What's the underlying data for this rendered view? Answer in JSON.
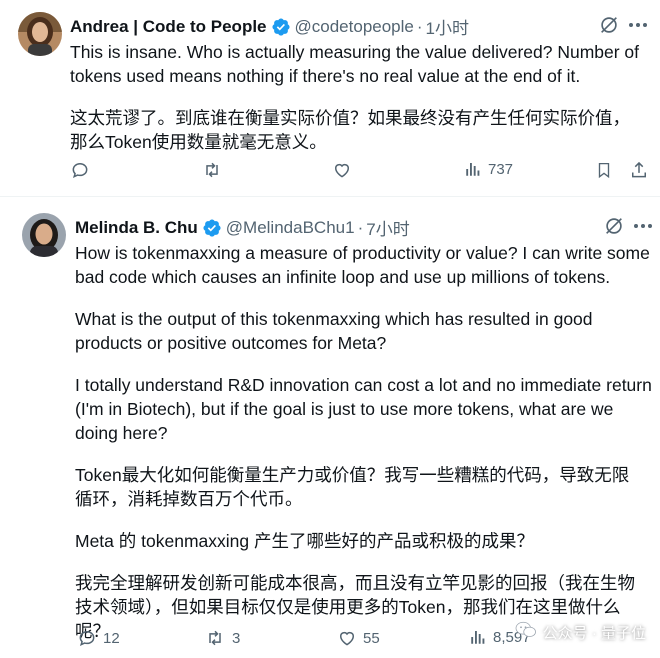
{
  "tweets": [
    {
      "author_name": "Andrea | Code to People",
      "handle": "@codetopeople",
      "separator": "·",
      "time": "1小时",
      "text_en": "This is insane. Who is actually measuring the value delivered? Number of tokens used means nothing if there's no real value at the end of it.",
      "text_zh": "这太荒谬了。到底谁在衡量实际价值？如果最终没有产生任何实际价值，那么Token使用数量就毫无意义。",
      "views": "737",
      "replies": "",
      "retweets": "",
      "likes": ""
    },
    {
      "author_name": "Melinda B. Chu",
      "handle": "@MelindaBChu1",
      "separator": "·",
      "time": "7小时",
      "paragraphs": [
        "How is tokenmaxxing a measure of productivity or value?  I can write some bad code which causes an infinite loop and use up millions of tokens.",
        "What is the output of this tokenmaxxing which has resulted in good products or positive outcomes for Meta?",
        "I totally understand R&D innovation can cost a lot and no immediate return (I'm in Biotech), but if the goal is just to use more tokens, what are we doing here?",
        "Token最大化如何能衡量生产力或价值？我写一些糟糕的代码，导致无限循环，消耗掉数百万个代币。",
        "Meta 的 tokenmaxxing 产生了哪些好的产品或积极的成果？",
        "我完全理解研发创新可能成本很高，而且没有立竿见影的回报（我在生物技术领域），但如果目标仅仅是使用更多的Token，那我们在这里做什么呢？"
      ],
      "replies": "12",
      "retweets": "3",
      "likes": "55",
      "views": "8,597"
    }
  ],
  "watermark": "公众号 · 量子位",
  "colors": {
    "text": "#0f1419",
    "muted": "#536471",
    "verified": "#1d9bf0",
    "divider": "#eff3f4"
  },
  "icons": [
    "grok-icon",
    "more-icon",
    "reply-icon",
    "retweet-icon",
    "like-icon",
    "views-icon",
    "bookmark-icon",
    "share-icon",
    "verified-badge-icon",
    "wechat-icon"
  ]
}
